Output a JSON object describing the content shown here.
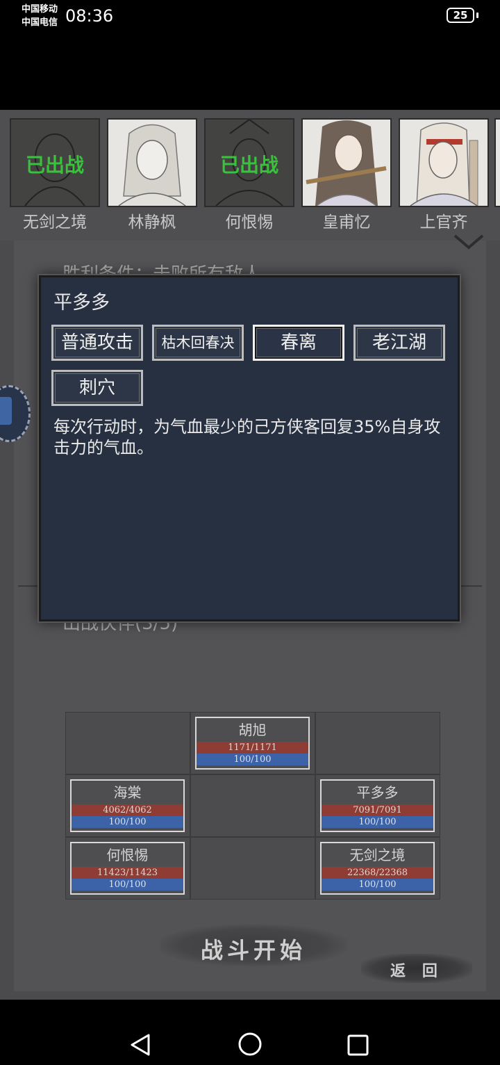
{
  "status_bar": {
    "carrier_1": "中国移动",
    "carrier_2": "中国电信",
    "time": "08:36",
    "battery": "25"
  },
  "heroes": [
    {
      "name": "无剑之境",
      "deployed": true,
      "deployed_label": "已出战"
    },
    {
      "name": "林静枫",
      "deployed": false
    },
    {
      "name": "何恨惕",
      "deployed": true,
      "deployed_label": "已出战"
    },
    {
      "name": "皇甫忆",
      "deployed": false
    },
    {
      "name": "上官齐",
      "deployed": false
    }
  ],
  "panel": {
    "win_condition": "胜利条件：击败所有敌人",
    "partners_label": "出战伙伴(3/5)"
  },
  "dialog": {
    "title": "平多多",
    "skills": [
      "普通攻击",
      "枯木回春决",
      "春离",
      "老江湖",
      "刺穴"
    ],
    "selected_skill": "春离",
    "description": "每次行动时，为气血最少的己方侠客回复35%自身攻击力的气血。"
  },
  "formation": {
    "units": [
      {
        "name": "胡旭",
        "hp": "1171/1171",
        "mp": "100/100"
      },
      {
        "name": "海棠",
        "hp": "4062/4062",
        "mp": "100/100"
      },
      {
        "name": "平多多",
        "hp": "7091/7091",
        "mp": "100/100"
      },
      {
        "name": "何恨惕",
        "hp": "11423/11423",
        "mp": "100/100"
      },
      {
        "name": "无剑之境",
        "hp": "22368/22368",
        "mp": "100/100"
      }
    ]
  },
  "buttons": {
    "start_battle": "战斗开始",
    "back": "返 回"
  },
  "colors": {
    "deployed_text": "#39c23b",
    "hp_bar": "#8e3c34",
    "mp_bar": "#3c63a8",
    "dialog_bg": "#263041"
  }
}
